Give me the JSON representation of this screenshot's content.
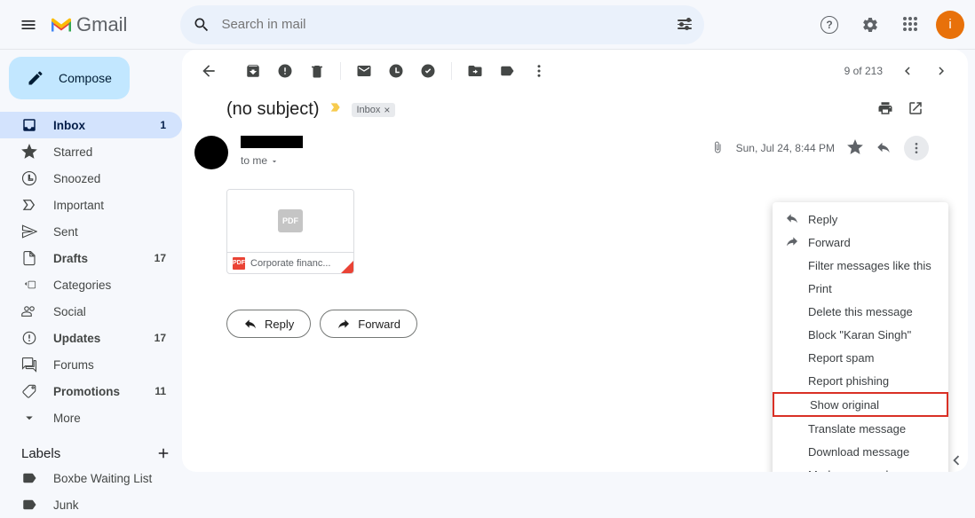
{
  "header": {
    "app_name": "Gmail",
    "search_placeholder": "Search in mail",
    "avatar_initial": "i"
  },
  "compose_label": "Compose",
  "sidebar": {
    "items": [
      {
        "label": "Inbox",
        "count": "1",
        "icon": "inbox",
        "active": true,
        "bold": true
      },
      {
        "label": "Starred",
        "count": "",
        "icon": "star",
        "active": false,
        "bold": false
      },
      {
        "label": "Snoozed",
        "count": "",
        "icon": "clock",
        "active": false,
        "bold": false
      },
      {
        "label": "Important",
        "count": "",
        "icon": "important",
        "active": false,
        "bold": false
      },
      {
        "label": "Sent",
        "count": "",
        "icon": "sent",
        "active": false,
        "bold": false
      },
      {
        "label": "Drafts",
        "count": "17",
        "icon": "draft",
        "active": false,
        "bold": true
      },
      {
        "label": "Categories",
        "count": "",
        "icon": "categories",
        "active": false,
        "bold": false
      },
      {
        "label": "Social",
        "count": "",
        "icon": "social",
        "active": false,
        "bold": false,
        "indent": true
      },
      {
        "label": "Updates",
        "count": "17",
        "icon": "updates",
        "active": false,
        "bold": true,
        "indent": true
      },
      {
        "label": "Forums",
        "count": "",
        "icon": "forums",
        "active": false,
        "bold": false,
        "indent": true
      },
      {
        "label": "Promotions",
        "count": "11",
        "icon": "promotions",
        "active": false,
        "bold": true,
        "indent": true
      },
      {
        "label": "More",
        "count": "",
        "icon": "more",
        "active": false,
        "bold": false
      }
    ],
    "labels_header": "Labels",
    "label_items": [
      {
        "label": "Boxbe Waiting List"
      },
      {
        "label": "Junk"
      }
    ]
  },
  "toolbar": {
    "page_counter": "9 of 213"
  },
  "subject_text": "(no subject)",
  "inbox_chip": "Inbox",
  "message": {
    "to_line": "to me",
    "date": "Sun, Jul 24, 8:44 PM"
  },
  "attachment": {
    "badge_text": "PDF",
    "name": "Corporate financ..."
  },
  "action_buttons": {
    "reply": "Reply",
    "forward": "Forward"
  },
  "context_menu": {
    "items": [
      {
        "label": "Reply",
        "icon": "reply"
      },
      {
        "label": "Forward",
        "icon": "forward"
      },
      {
        "label": "Filter messages like this"
      },
      {
        "label": "Print"
      },
      {
        "label": "Delete this message"
      },
      {
        "label": "Block \"Karan Singh\""
      },
      {
        "label": "Report spam"
      },
      {
        "label": "Report phishing"
      },
      {
        "label": "Show original",
        "highlight": true
      },
      {
        "label": "Translate message"
      },
      {
        "label": "Download message"
      },
      {
        "label": "Mark as unread"
      }
    ]
  }
}
